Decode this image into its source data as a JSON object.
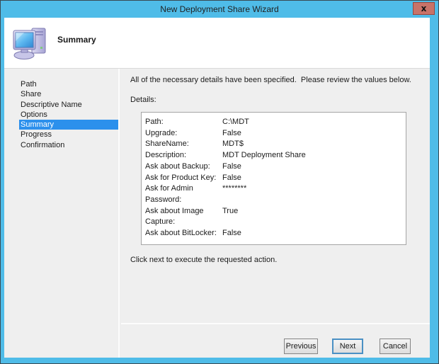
{
  "window": {
    "title": "New Deployment Share Wizard",
    "close_glyph": "x"
  },
  "header": {
    "title": "Summary",
    "icon": "computer-icon"
  },
  "sidebar": {
    "items": [
      {
        "label": "Path",
        "selected": false
      },
      {
        "label": "Share",
        "selected": false
      },
      {
        "label": "Descriptive Name",
        "selected": false
      },
      {
        "label": "Options",
        "selected": false
      },
      {
        "label": "Summary",
        "selected": true
      },
      {
        "label": "Progress",
        "selected": false
      },
      {
        "label": "Confirmation",
        "selected": false
      }
    ]
  },
  "content": {
    "intro": "All of the necessary details have been specified.  Please review the values below.",
    "details_label": "Details:",
    "details": [
      {
        "label": "Path:",
        "value": "C:\\MDT"
      },
      {
        "label": "Upgrade:",
        "value": "False"
      },
      {
        "label": "ShareName:",
        "value": "MDT$"
      },
      {
        "label": "Description:",
        "value": "MDT Deployment Share"
      },
      {
        "label": "Ask about Backup:",
        "value": "False"
      },
      {
        "label": "Ask for Product Key:",
        "value": "False"
      },
      {
        "label": "Ask for Admin Password:",
        "value": "********"
      },
      {
        "label": "Ask about Image Capture:",
        "value": "True"
      },
      {
        "label": "Ask about BitLocker:",
        "value": "False"
      }
    ],
    "note": "Click next to execute the requested action."
  },
  "footer": {
    "previous": "Previous",
    "next": "Next",
    "cancel": "Cancel"
  },
  "colors": {
    "frame": "#4fbce8",
    "selection": "#2c90ec",
    "close_button": "#c87369",
    "screen_blue": "#5db8f0"
  }
}
